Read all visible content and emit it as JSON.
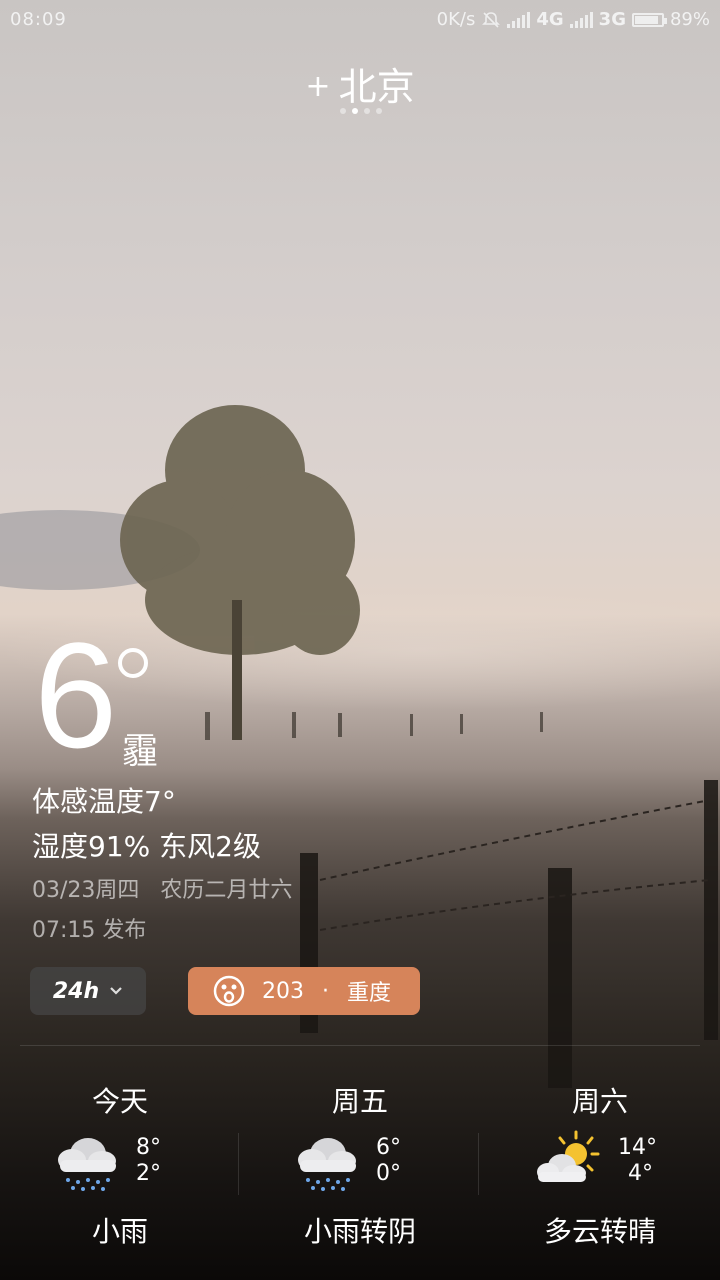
{
  "status_bar": {
    "time": "08:09",
    "speed": "0K/s",
    "net1": "4G",
    "net2": "3G",
    "battery_pct": 89,
    "battery_label": "89%"
  },
  "header": {
    "plus": "+",
    "city": "北京",
    "page_count": 4,
    "active_page": 1
  },
  "current": {
    "temp": "6",
    "condition": "霾",
    "feels_like": "体感温度7°",
    "humidity": "湿度91%",
    "wind": "东风2级",
    "date": "03/23周四",
    "lunar": "农历二月廿六",
    "publish_time": "07:15",
    "publish_label": "发布"
  },
  "controls": {
    "h24_label": "24h",
    "aqi_value": "203",
    "aqi_sep": "·",
    "aqi_level": "重度"
  },
  "forecast": [
    {
      "day": "今天",
      "high": "8°",
      "low": "2°",
      "desc": "小雨",
      "icon": "cloud-rain-icon"
    },
    {
      "day": "周五",
      "high": "6°",
      "low": "0°",
      "desc": "小雨转阴",
      "icon": "cloud-rain-icon"
    },
    {
      "day": "周六",
      "high": "14°",
      "low": "4°",
      "desc": "多云转晴",
      "icon": "sun-cloud-icon"
    }
  ],
  "colors": {
    "aqi_badge": "#d6845a",
    "sun": "#f4c230"
  }
}
